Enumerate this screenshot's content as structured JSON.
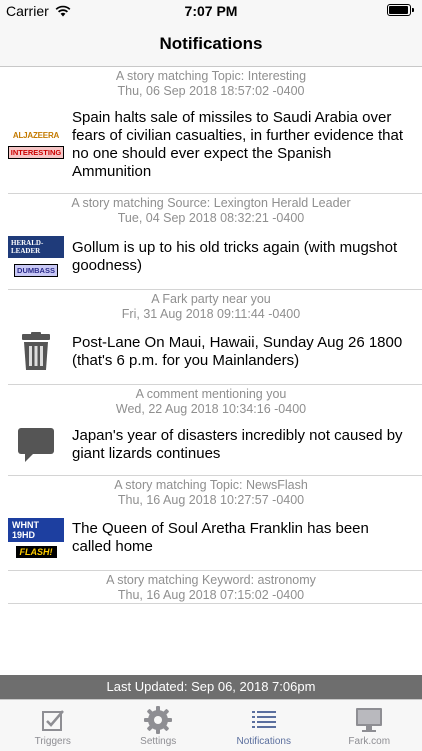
{
  "status_bar": {
    "carrier": "Carrier",
    "time": "7:07 PM"
  },
  "nav": {
    "title": "Notifications"
  },
  "notifications": [
    {
      "header": "A story matching Topic: Interesting",
      "date": "Thu, 06 Sep 2018 18:57:02 -0400",
      "text": "Spain halts sale of missiles to Saudi Arabia over fears of civilian casualties, in further evidence that no one should ever expect the Spanish Ammunition",
      "logo": "ALJAZEERA",
      "badge": "INTERESTING"
    },
    {
      "header": "A story matching Source: Lexington Herald Leader",
      "date": "Tue, 04 Sep 2018 08:32:21 -0400",
      "text": "Gollum is up to his old tricks again (with mugshot goodness)",
      "logo": "HERALD-LEADER",
      "badge": "DUMBASS"
    },
    {
      "header": "A Fark party near you",
      "date": "Fri, 31 Aug 2018 09:11:44 -0400",
      "text": "Post-Lane On Maui, Hawaii, Sunday Aug 26 1800 (that's 6 p.m. for you Mainlanders)",
      "icon": "trash-can-icon"
    },
    {
      "header": "A comment mentioning you",
      "date": "Wed, 22 Aug 2018 10:34:16 -0400",
      "text": "Japan's year of disasters incredibly not caused by giant lizards continues",
      "icon": "speech-bubble-icon"
    },
    {
      "header": "A story matching Topic: NewsFlash",
      "date": "Thu, 16 Aug 2018 10:27:57 -0400",
      "text": "The Queen of Soul Aretha Franklin has been called home",
      "logo": "WHNT 19HD",
      "badge": "FLASH!"
    },
    {
      "header": "A story matching Keyword: astronomy",
      "date": "Thu, 16 Aug 2018 07:15:02 -0400"
    }
  ],
  "last_updated": "Last Updated: Sep 06, 2018 7:06pm",
  "tabs": [
    {
      "label": "Triggers",
      "icon": "checkbox-icon"
    },
    {
      "label": "Settings",
      "icon": "gear-icon"
    },
    {
      "label": "Notifications",
      "icon": "list-icon"
    },
    {
      "label": "Fark.com",
      "icon": "monitor-icon"
    }
  ],
  "colors": {
    "active_tab": "#5b6f9e",
    "inactive_tab": "#8e8e93",
    "updated_bar": "#6e6e6e"
  }
}
